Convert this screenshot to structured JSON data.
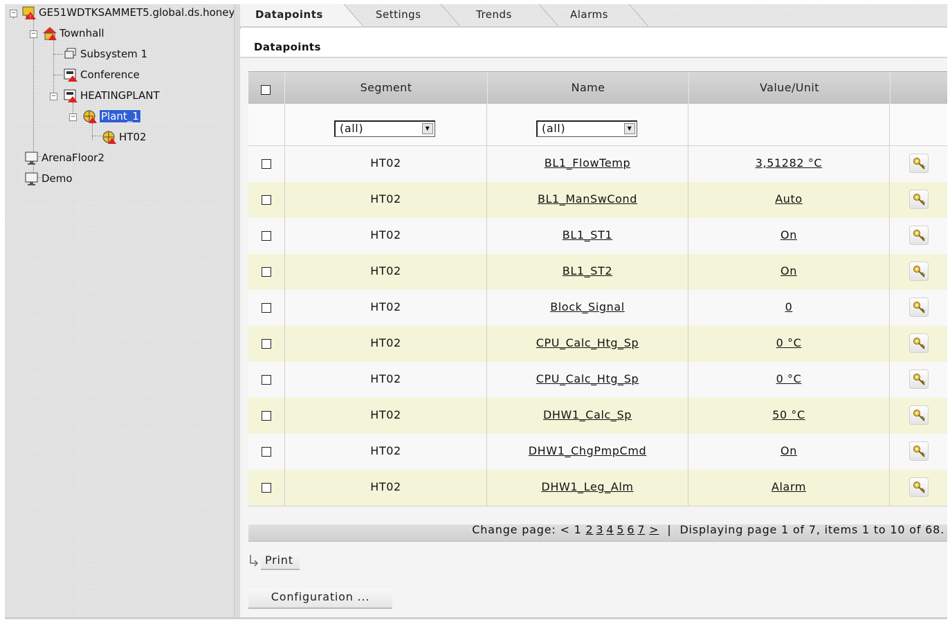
{
  "tree": {
    "root": "GE51WDTKSAMMET5.global.ds.honey",
    "items": [
      "Townhall",
      "Subsystem 1",
      "Conference",
      "HEATINGPLANT",
      "Plant_1",
      "HT02",
      "ArenaFloor2",
      "Demo"
    ]
  },
  "tabs": [
    "Datapoints",
    "Settings",
    "Trends",
    "Alarms"
  ],
  "section_title": "Datapoints",
  "columns": [
    "Segment",
    "Name",
    "Value/Unit"
  ],
  "filters": {
    "segment": "(all)",
    "name": "(all)"
  },
  "rows": [
    {
      "segment": "HT02",
      "name": "BL1_FlowTemp",
      "value": "3,51282 °C"
    },
    {
      "segment": "HT02",
      "name": "BL1_ManSwCond",
      "value": "Auto"
    },
    {
      "segment": "HT02",
      "name": "BL1_ST1",
      "value": "On"
    },
    {
      "segment": "HT02",
      "name": "BL1_ST2",
      "value": "On"
    },
    {
      "segment": "HT02",
      "name": "Block_Signal",
      "value": "0"
    },
    {
      "segment": "HT02",
      "name": "CPU_Calc_Htg_Sp",
      "value": "0 °C"
    },
    {
      "segment": "HT02",
      "name": "CPU_Calc_Htg_Sp",
      "value": "0 °C"
    },
    {
      "segment": "HT02",
      "name": "DHW1_Calc_Sp",
      "value": "50 °C"
    },
    {
      "segment": "HT02",
      "name": "DHW1_ChgPmpCmd",
      "value": "On"
    },
    {
      "segment": "HT02",
      "name": "DHW1_Leg_Alm",
      "value": "Alarm"
    }
  ],
  "pager": {
    "label": "Change page:",
    "prev": "<",
    "current": "1",
    "pages": [
      "2",
      "3",
      "4",
      "5",
      "6",
      "7"
    ],
    "next": ">",
    "separator": "|",
    "summary": "Displaying page 1 of 7, items 1 to 10 of 68."
  },
  "buttons": {
    "print": "Print",
    "configuration": "Configuration ..."
  }
}
